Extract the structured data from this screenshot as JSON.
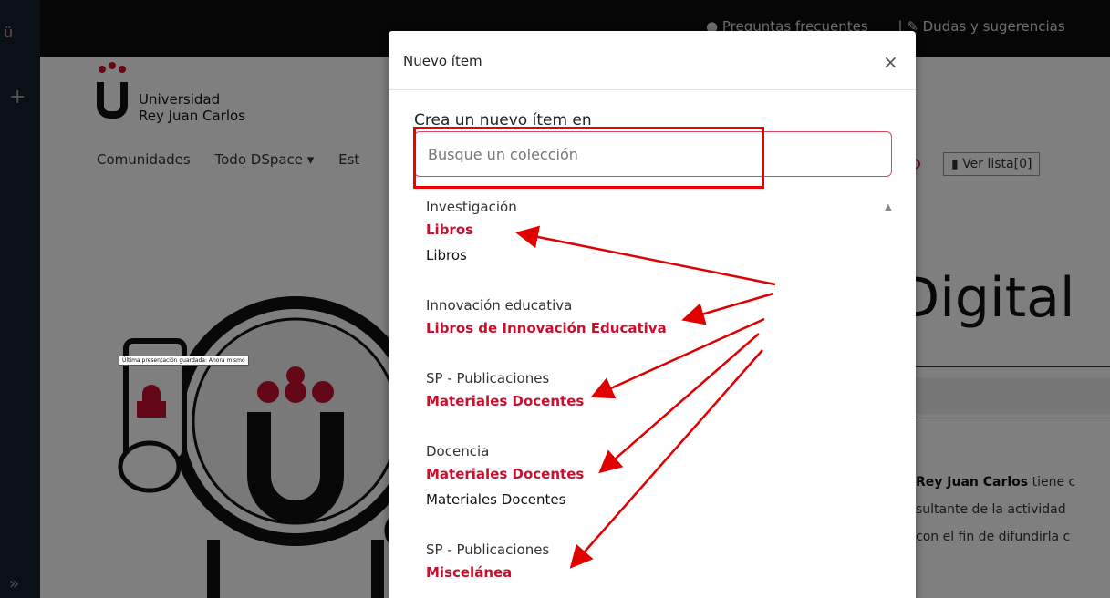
{
  "topbar": {
    "faq": "Preguntas frecuentes",
    "suggestions": "Dudas y sugerencias"
  },
  "brand": {
    "line1": "Universidad",
    "line2": "Rey Juan Carlos"
  },
  "nav": {
    "item1": "Comunidades",
    "item2": "Todo DSpace ▾",
    "item3": "Est"
  },
  "verlista": "Ver lista[0]",
  "hero": {
    "title": "Digital",
    "para_bold": "Rey Juan Carlos",
    "para_rest1": " tiene c",
    "para_line2": "sultante de la actividad",
    "para_line3": "con el fin de difundirla c"
  },
  "status_tip": "Última presentación guardada: Ahora mismo",
  "modal": {
    "title": "Nuevo ítem",
    "close": "×",
    "subtitle": "Crea un nuevo ítem en",
    "search_placeholder": "Busque un colección",
    "groups": [
      {
        "community": "Investigación",
        "collections": [
          {
            "label": "Libros",
            "highlighted": true
          },
          {
            "label": "Libros",
            "highlighted": false
          }
        ]
      },
      {
        "community": "Innovación educativa",
        "collections": [
          {
            "label": "Libros de Innovación Educativa",
            "highlighted": true
          }
        ]
      },
      {
        "community": "SP - Publicaciones",
        "collections": [
          {
            "label": "Materiales Docentes",
            "highlighted": true
          }
        ]
      },
      {
        "community": "Docencia",
        "collections": [
          {
            "label": "Materiales Docentes",
            "highlighted": true
          },
          {
            "label": "Materiales Docentes",
            "highlighted": false
          }
        ]
      },
      {
        "community": "SP - Publicaciones",
        "collections": [
          {
            "label": "Miscelánea",
            "highlighted": true
          }
        ]
      }
    ]
  },
  "colors": {
    "accent": "#c8102e",
    "annotation": "#e00000"
  }
}
